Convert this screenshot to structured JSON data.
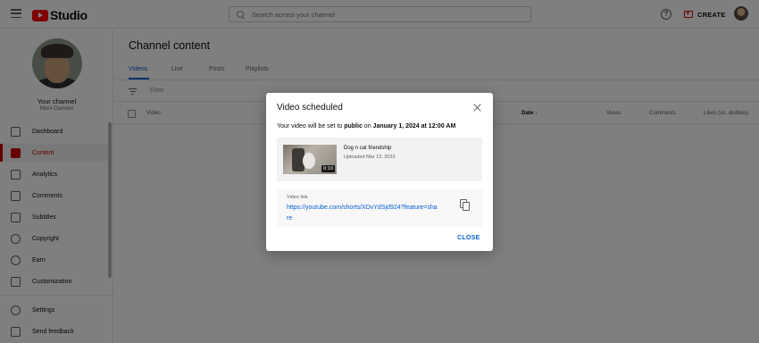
{
  "topbar": {
    "logo_text": "Studio",
    "search_placeholder": "Search across your channel",
    "create_label": "CREATE",
    "help_glyph": "?"
  },
  "sidebar": {
    "channel_title": "Your channel",
    "channel_name": "Moni Clement",
    "items": [
      {
        "label": "Dashboard",
        "icon": "dashboard-icon"
      },
      {
        "label": "Content",
        "icon": "content-icon",
        "active": true
      },
      {
        "label": "Analytics",
        "icon": "analytics-icon"
      },
      {
        "label": "Comments",
        "icon": "comments-icon"
      },
      {
        "label": "Subtitles",
        "icon": "subtitles-icon"
      },
      {
        "label": "Copyright",
        "icon": "copyright-icon"
      },
      {
        "label": "Earn",
        "icon": "earn-icon"
      },
      {
        "label": "Customization",
        "icon": "customization-icon"
      }
    ],
    "bottom_items": [
      {
        "label": "Settings",
        "icon": "settings-icon"
      },
      {
        "label": "Send feedback",
        "icon": "feedback-icon"
      }
    ]
  },
  "main": {
    "title": "Channel content",
    "tabs": [
      {
        "label": "Videos",
        "active": true
      },
      {
        "label": "Live"
      },
      {
        "label": "Posts"
      },
      {
        "label": "Playlists"
      }
    ],
    "filter_label": "Filter",
    "columns": [
      "Video",
      "Date",
      "Views",
      "Comments",
      "Likes (vs. dislikes)"
    ],
    "sort_indicator": "↓"
  },
  "dialog": {
    "title": "Video scheduled",
    "message_prefix": "Your video will be set to ",
    "message_visibility": "public",
    "message_mid": " on ",
    "message_datetime": "January 1, 2024 at 12:00 AM",
    "video": {
      "title": "Dog n cat friendship",
      "uploaded": "Uploaded Mar 13, 2023",
      "duration": "0:10"
    },
    "link_label": "Video link",
    "link_url": "https://youtube.com/shorts/XDvYdSjd924?feature=share",
    "close_label": "CLOSE"
  },
  "colors": {
    "accent_red": "#cc0000",
    "brand_red": "#ff0000",
    "link_blue": "#065fd4",
    "overlay": "rgba(0,0,0,0.5)"
  }
}
